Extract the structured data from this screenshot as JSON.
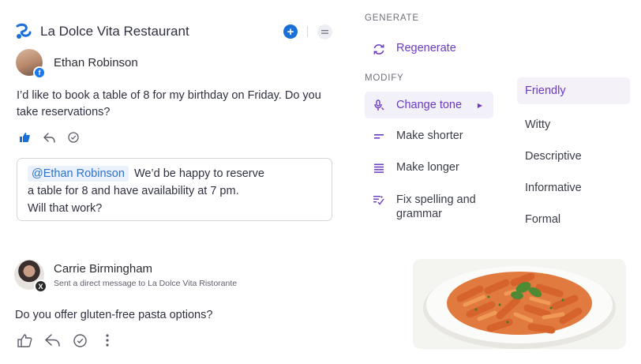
{
  "header": {
    "title": "La Dolce Vita Restaurant"
  },
  "post1": {
    "author": "Ethan Robinson",
    "message": "I’d like to book a table of 8 for my birthday on Friday. Do you take reservations?"
  },
  "reply": {
    "mention": "@Ethan Robinson",
    "line1": "We’d be happy to reserve",
    "line2": "a table for 8 and have availability at 7 pm.",
    "line3": "Will that work?"
  },
  "post2": {
    "author": "Carrie Birmingham",
    "subtitle": "Sent a direct message to La Dolce Vita Ristorante",
    "message": "Do you offer gluten-free pasta options?"
  },
  "menu": {
    "generate_label": "GENERATE",
    "regenerate": "Regenerate",
    "modify_label": "MODIFY",
    "change_tone": "Change tone",
    "make_shorter": "Make shorter",
    "make_longer": "Make longer",
    "fix_spelling": "Fix spelling and grammar"
  },
  "tones": [
    "Friendly",
    "Witty",
    "Descriptive",
    "Informative",
    "Formal"
  ],
  "selected_tone": "Friendly",
  "colors": {
    "accent": "#6a3bc2",
    "brand_blue": "#1a6fd8",
    "mention_bg": "#eaf1fb"
  },
  "icons": {
    "brand": "brand-logo-icon",
    "post1_social": "facebook-icon",
    "post2_social": "x-icon"
  }
}
